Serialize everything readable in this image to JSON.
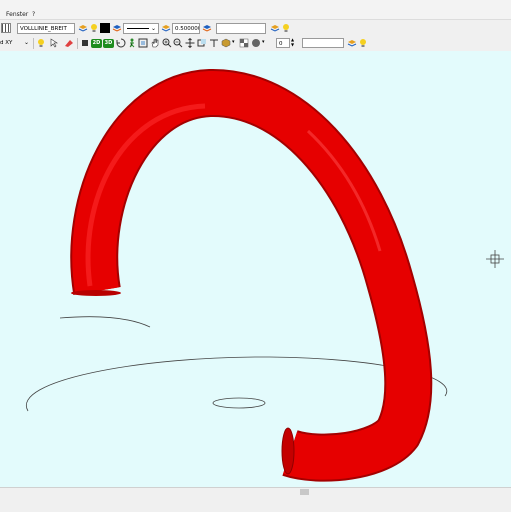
{
  "menu": {
    "items": [
      "Fenster",
      "?"
    ]
  },
  "toolbar1": {
    "line_style_name": "VOLLLINIE_BREIT",
    "line_width_value": "0.500000",
    "layer_field_value": ""
  },
  "toolbar2": {
    "view_label": "d XY",
    "btn_2d": "2D",
    "btn_3d": "3D",
    "spin_value": "0",
    "field_value": ""
  },
  "colors": {
    "viewport_bg": "#e3fbfc",
    "tube_red": "#e60000",
    "tube_dark": "#a80000",
    "btn_green": "#1e8c1e"
  },
  "icons": [
    "layers-icon",
    "lightbulb-icon",
    "color-swatch-icon",
    "line-type-icon",
    "zoom-icon",
    "pan-hand-icon",
    "rotate-icon",
    "cube-icon",
    "crosshair-cursor-icon"
  ]
}
